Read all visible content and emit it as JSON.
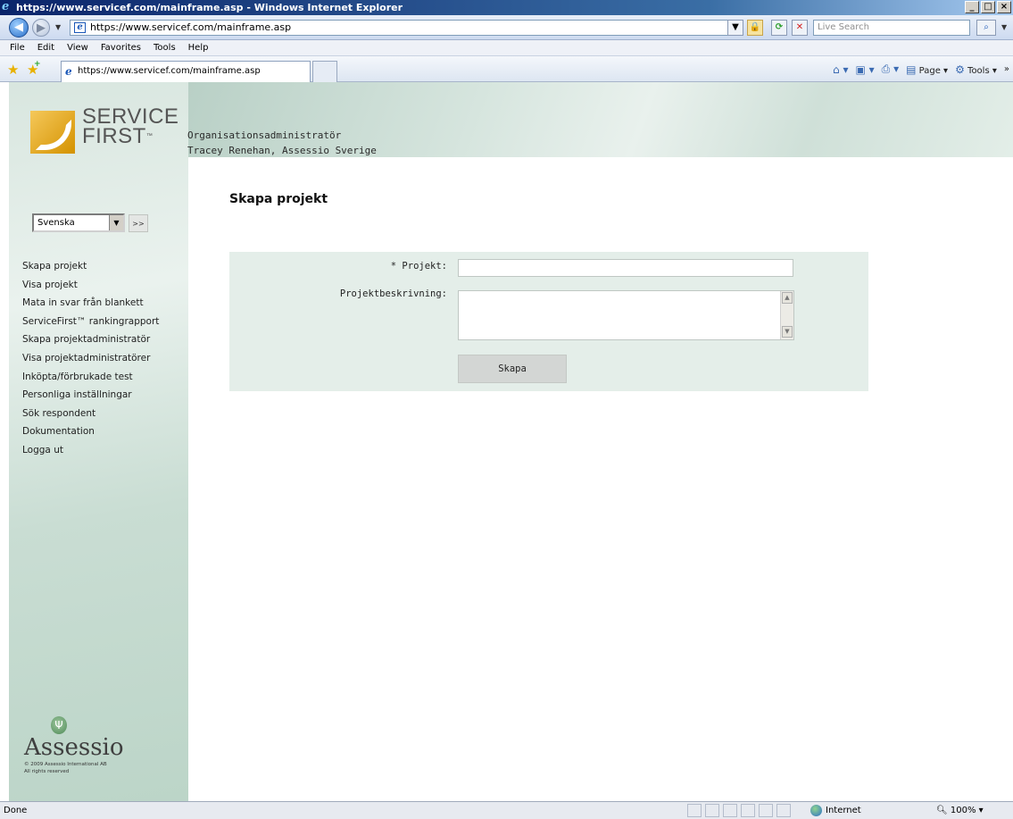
{
  "window": {
    "title": "https://www.servicef.com/mainframe.asp - Windows Internet Explorer",
    "controls": [
      "_",
      "□",
      "×"
    ]
  },
  "navbar": {
    "address": "https://www.servicef.com/mainframe.asp",
    "search_placeholder": "Live Search"
  },
  "menubar": [
    "File",
    "Edit",
    "View",
    "Favorites",
    "Tools",
    "Help"
  ],
  "favbar": {
    "tab_title": "https://www.servicef.com/mainframe.asp",
    "page_label": "Page",
    "tools_label": "Tools"
  },
  "logo": {
    "line1": "SERVICE",
    "line2": "FIRST",
    "tm": "™"
  },
  "language": {
    "selected": "Svenska",
    "go_label": ">>"
  },
  "nav": [
    "Skapa projekt",
    "Visa projekt",
    "Mata in svar från blankett",
    "ServiceFirst™ rankingrapport",
    "Skapa projektadministratör",
    "Visa projektadministratörer",
    "Inköpta/förbrukade test",
    "Personliga inställningar",
    "Sök respondent",
    "Dokumentation",
    "Logga ut"
  ],
  "user": {
    "role": "Organisationsadministratör",
    "name": "Tracey Renehan, Assessio Sverige"
  },
  "page_title": "Skapa projekt",
  "form": {
    "projekt_label": "* Projekt:",
    "projekt_value": "",
    "desc_label": "Projektbeskrivning:",
    "desc_value": "",
    "submit_label": "Skapa"
  },
  "footer": {
    "brand": "Assessio",
    "copyright_line1": "© 2009 Assessio International AB",
    "copyright_line2": "All rights reserved"
  },
  "status": {
    "text": "Done",
    "zone": "Internet",
    "zoom": "100%"
  },
  "colors": {
    "sidebar": "#d3e4dc",
    "form_panel": "#e4eee9",
    "logo_gold": "#e0a520"
  }
}
